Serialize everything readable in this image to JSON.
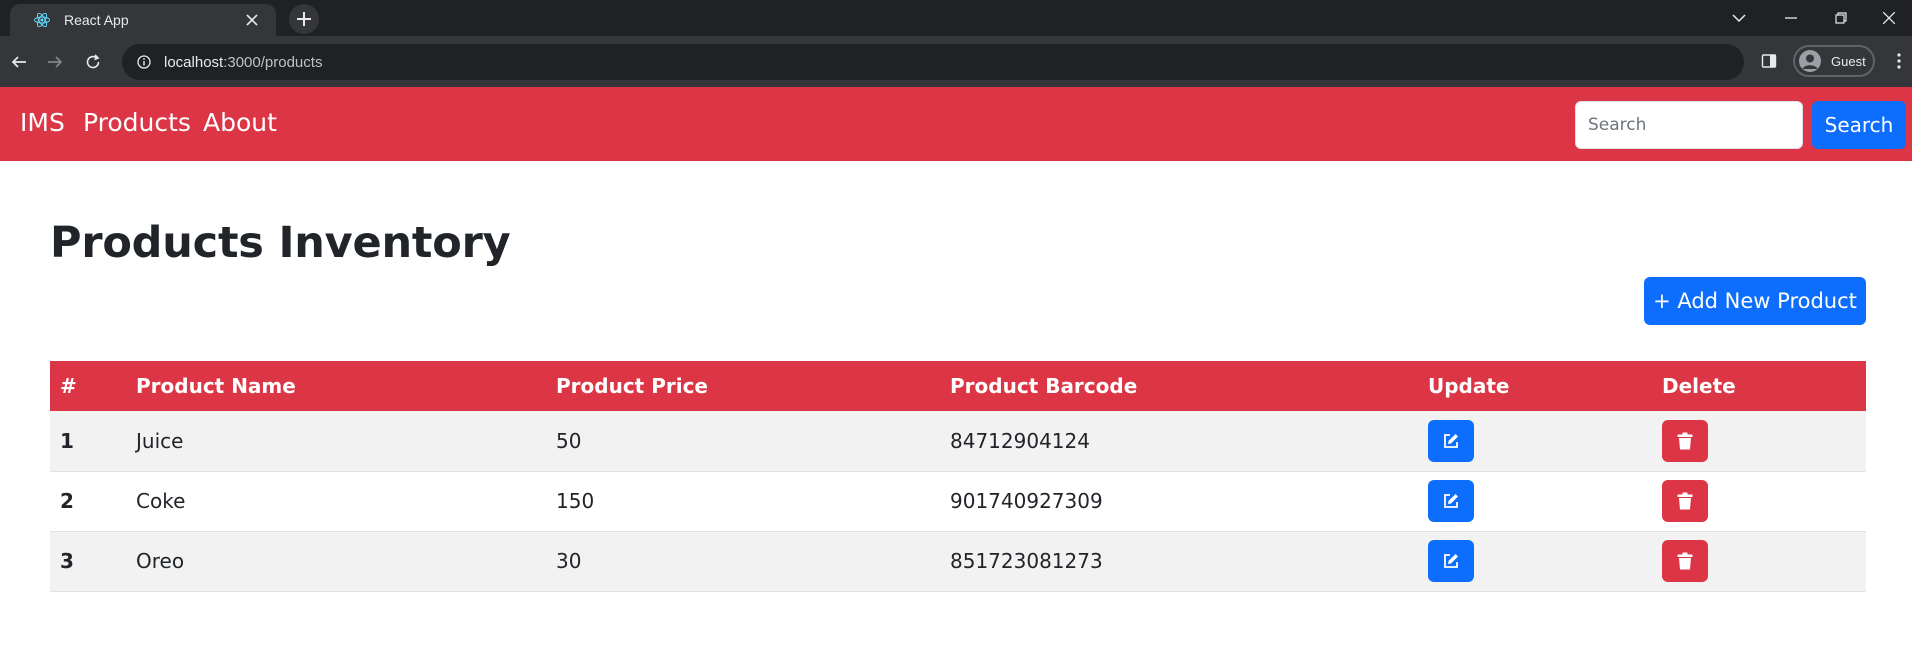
{
  "browser": {
    "tab_title": "React App",
    "url_host": "localhost",
    "url_path": ":3000/products",
    "profile_label": "Guest"
  },
  "navbar": {
    "brand": "IMS",
    "links": [
      "Products",
      "About"
    ],
    "search_placeholder": "Search",
    "search_button": "Search"
  },
  "page": {
    "title": "Products Inventory",
    "add_button": "+ Add New Product"
  },
  "table": {
    "headers": [
      "#",
      "Product Name",
      "Product Price",
      "Product Barcode",
      "Update",
      "Delete"
    ],
    "rows": [
      {
        "index": "1",
        "name": "Juice",
        "price": "50",
        "barcode": "84712904124"
      },
      {
        "index": "2",
        "name": "Coke",
        "price": "150",
        "barcode": "901740927309"
      },
      {
        "index": "3",
        "name": "Oreo",
        "price": "30",
        "barcode": "851723081273"
      }
    ]
  },
  "icons": {
    "update": "edit-icon",
    "delete": "trash-icon"
  },
  "colors": {
    "navbar": "#dc3545",
    "primary": "#0d6efd",
    "danger": "#dc3545",
    "browser_frame": "#202124"
  }
}
